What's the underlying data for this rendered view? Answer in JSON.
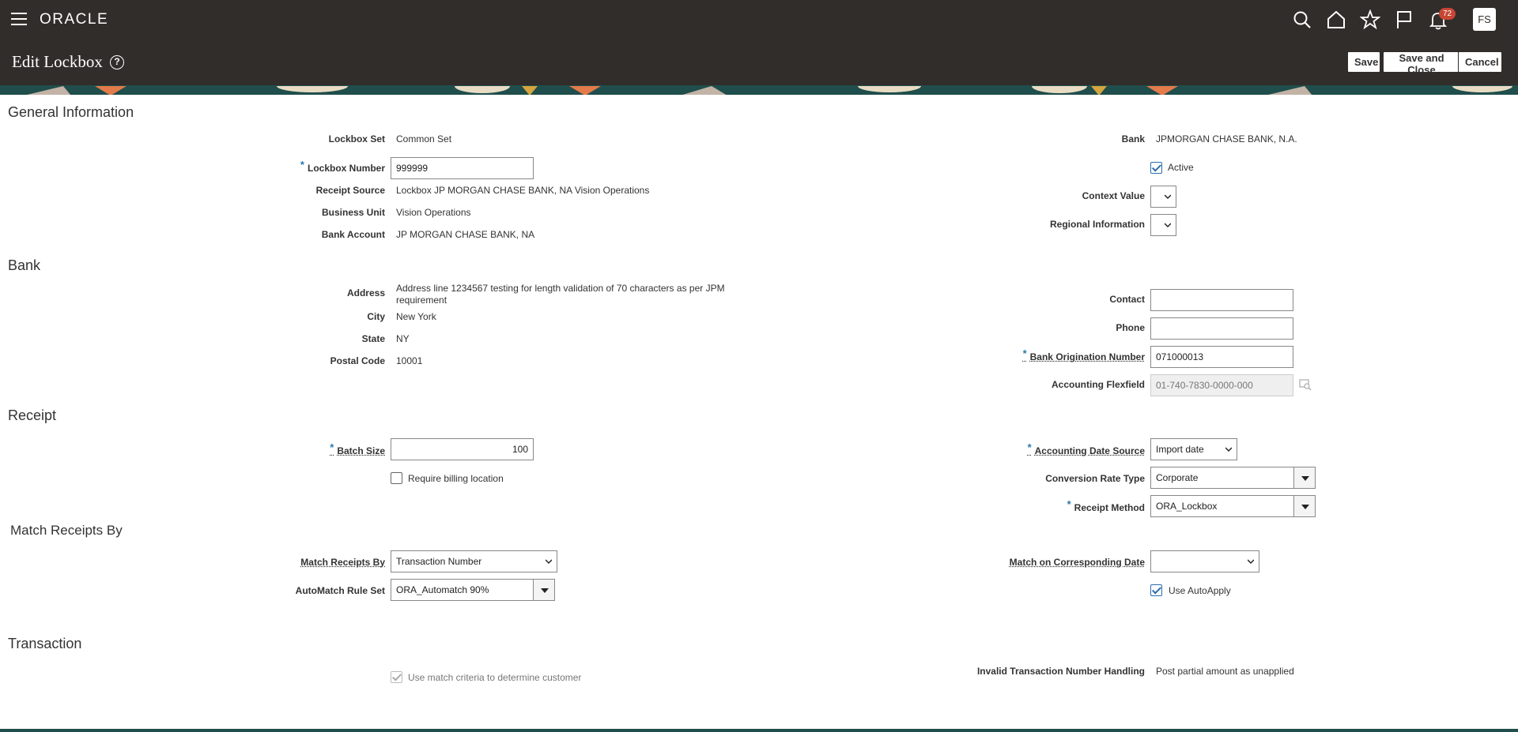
{
  "header": {
    "brand": "ORACLE",
    "notification_count": "72",
    "avatar_initials": "FS",
    "page_title": "Edit Lockbox",
    "help_glyph": "?",
    "buttons": {
      "save": "Save",
      "save_close": "Save and Close",
      "cancel": "Cancel"
    }
  },
  "sections": {
    "general": "General Information",
    "bank": "Bank",
    "receipt": "Receipt",
    "match": "Match Receipts By",
    "transaction": "Transaction"
  },
  "general": {
    "lockbox_set_label": "Lockbox Set",
    "lockbox_set": "Common Set",
    "lockbox_number_label": "Lockbox Number",
    "lockbox_number": "999999",
    "receipt_source_label": "Receipt Source",
    "receipt_source": "Lockbox JP MORGAN CHASE BANK, NA Vision Operations",
    "business_unit_label": "Business Unit",
    "business_unit": "Vision Operations",
    "bank_account_label": "Bank Account",
    "bank_account": "JP MORGAN CHASE BANK, NA",
    "bank_label": "Bank",
    "bank": "JPMORGAN CHASE BANK, N.A.",
    "active_label": "Active",
    "active": true,
    "context_value_label": "Context Value",
    "regional_info_label": "Regional Information"
  },
  "bank": {
    "address_label": "Address",
    "address_line1": "Address line 1234567 testing for length validation of 70 characters as per JPM",
    "address_line2": "requirement",
    "city_label": "City",
    "city": "New York",
    "state_label": "State",
    "state": "NY",
    "postal_label": "Postal Code",
    "postal": "10001",
    "contact_label": "Contact",
    "contact": "",
    "phone_label": "Phone",
    "phone": "",
    "origination_label": "Bank Origination Number",
    "origination": "071000013",
    "flexfield_label": "Accounting Flexfield",
    "flexfield": "01-740-7830-0000-000"
  },
  "receipt": {
    "batch_size_label": "Batch Size",
    "batch_size": "100",
    "billing_label": "Require billing location",
    "billing": false,
    "date_source_label": "Accounting Date Source",
    "date_source": "Import date",
    "rate_type_label": "Conversion Rate Type",
    "rate_type": "Corporate",
    "method_label": "Receipt Method",
    "method": "ORA_Lockbox"
  },
  "match": {
    "match_by_label": "Match Receipts By",
    "match_by": "Transaction Number",
    "rule_set_label": "AutoMatch Rule Set",
    "rule_set": "ORA_Automatch 90%",
    "corr_date_label": "Match on Corresponding Date",
    "corr_date": "",
    "autoapply_label": "Use AutoApply",
    "autoapply": true
  },
  "transaction": {
    "criteria_label": "Use match criteria to determine customer",
    "criteria": true,
    "invalid_label": "Invalid Transaction Number Handling",
    "invalid": "Post partial amount as unapplied"
  },
  "colors": {
    "header_bg": "#312d2a",
    "accent_teal": "#1f4e4c",
    "badge": "#c74634",
    "required": "#2a7ab0"
  }
}
